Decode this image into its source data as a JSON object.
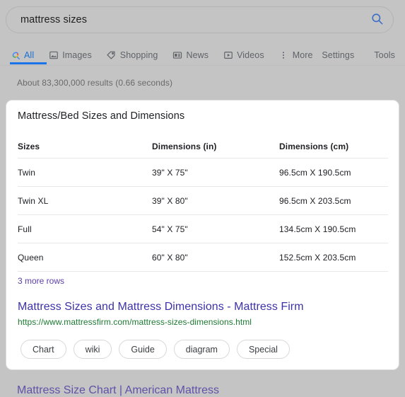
{
  "search": {
    "value": "mattress sizes",
    "placeholder": "Search",
    "search_icon": "search-icon"
  },
  "nav": {
    "tabs": [
      {
        "label": "All",
        "icon": "google-search-icon",
        "active": true
      },
      {
        "label": "Images",
        "icon": "image-icon",
        "active": false
      },
      {
        "label": "Shopping",
        "icon": "tag-icon",
        "active": false
      },
      {
        "label": "News",
        "icon": "newspaper-icon",
        "active": false
      },
      {
        "label": "Videos",
        "icon": "video-play-icon",
        "active": false
      },
      {
        "label": "More",
        "icon": "more-vertical-icon",
        "active": false
      }
    ],
    "settings_label": "Settings",
    "tools_label": "Tools"
  },
  "result_stats": "About 83,300,000 results (0.66 seconds)",
  "card": {
    "title": "Mattress/Bed Sizes and Dimensions",
    "table": {
      "columns": [
        "Sizes",
        "Dimensions (in)",
        "Dimensions (cm)"
      ],
      "rows": [
        [
          "Twin",
          "39\" X 75\"",
          "96.5cm X 190.5cm"
        ],
        [
          "Twin XL",
          "39\" X 80\"",
          "96.5cm X 203.5cm"
        ],
        [
          "Full",
          "54\" X 75\"",
          "134.5cm X 190.5cm"
        ],
        [
          "Queen",
          "60\" X 80\"",
          "152.5cm X 203.5cm"
        ]
      ]
    },
    "more_rows_label": "3 more rows",
    "result_title": "Mattress Sizes and Mattress Dimensions - Mattress Firm",
    "result_url": "https://www.mattressfirm.com/mattress-sizes-dimensions.html",
    "chips": [
      "Chart",
      "wiki",
      "Guide",
      "diagram",
      "Special"
    ]
  },
  "next_result": {
    "title": "Mattress Size Chart | American Mattress"
  },
  "colors": {
    "page_background": "#c4c4c4",
    "card_background": "#ffffff",
    "active_tab": "#1a6fd4",
    "tab_underline": "#1a73e8",
    "link_visited": "#3c32a8",
    "url_green": "#1d7a33",
    "more_rows": "#5b3ea8"
  }
}
